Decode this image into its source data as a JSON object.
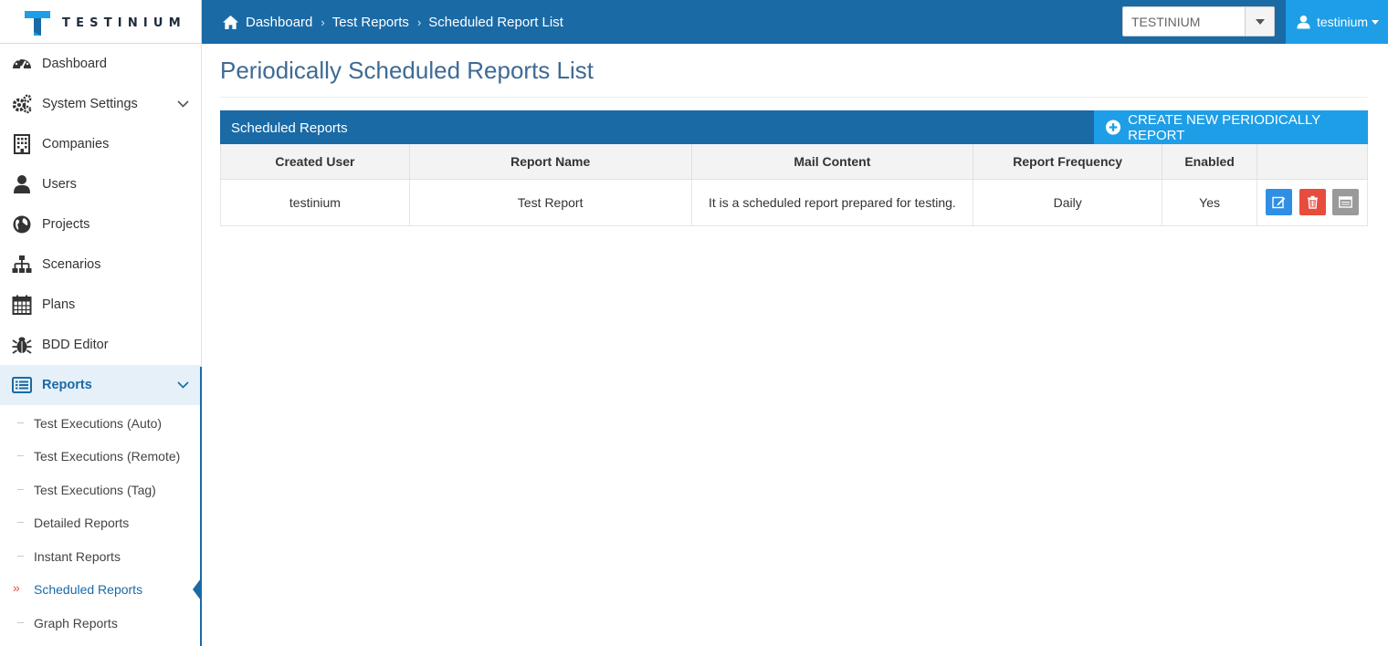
{
  "app": {
    "logo_text": "TESTINIUM"
  },
  "breadcrumb": [
    "Dashboard",
    "Test Reports",
    "Scheduled Report List"
  ],
  "company_select": {
    "value": "TESTINIUM"
  },
  "user_menu": {
    "name": "testinium"
  },
  "sidebar": {
    "items": [
      {
        "label": "Dashboard",
        "icon": "dashboard-icon"
      },
      {
        "label": "System Settings",
        "icon": "gears-icon"
      },
      {
        "label": "Companies",
        "icon": "building-icon"
      },
      {
        "label": "Users",
        "icon": "user-icon"
      },
      {
        "label": "Projects",
        "icon": "globe-icon"
      },
      {
        "label": "Scenarios",
        "icon": "sitemap-icon"
      },
      {
        "label": "Plans",
        "icon": "calendar-icon"
      },
      {
        "label": "BDD Editor",
        "icon": "bug-icon"
      },
      {
        "label": "Reports",
        "icon": "list-icon"
      }
    ],
    "sub_items": [
      "Test Executions (Auto)",
      "Test Executions (Remote)",
      "Test Executions (Tag)",
      "Detailed Reports",
      "Instant Reports",
      "Scheduled Reports",
      "Graph Reports"
    ],
    "active_item": "Reports",
    "active_sub_item": "Scheduled Reports"
  },
  "main": {
    "title": "Periodically Scheduled Reports List",
    "panel_title": "Scheduled Reports",
    "create_button": "CREATE NEW PERIODICALLY REPORT",
    "table": {
      "columns": [
        "Created User",
        "Report Name",
        "Mail Content",
        "Report Frequency",
        "Enabled",
        ""
      ],
      "rows": [
        {
          "created_user": "testinium",
          "report_name": "Test Report",
          "mail_content": "It is a scheduled report prepared for testing.",
          "frequency": "Daily",
          "enabled": "Yes"
        }
      ]
    }
  },
  "colors": {
    "primary": "#1a6aa6",
    "accent": "#1e9ee6",
    "edit": "#2f8fe5",
    "delete": "#e84c3d",
    "view": "#9a9a9a"
  }
}
